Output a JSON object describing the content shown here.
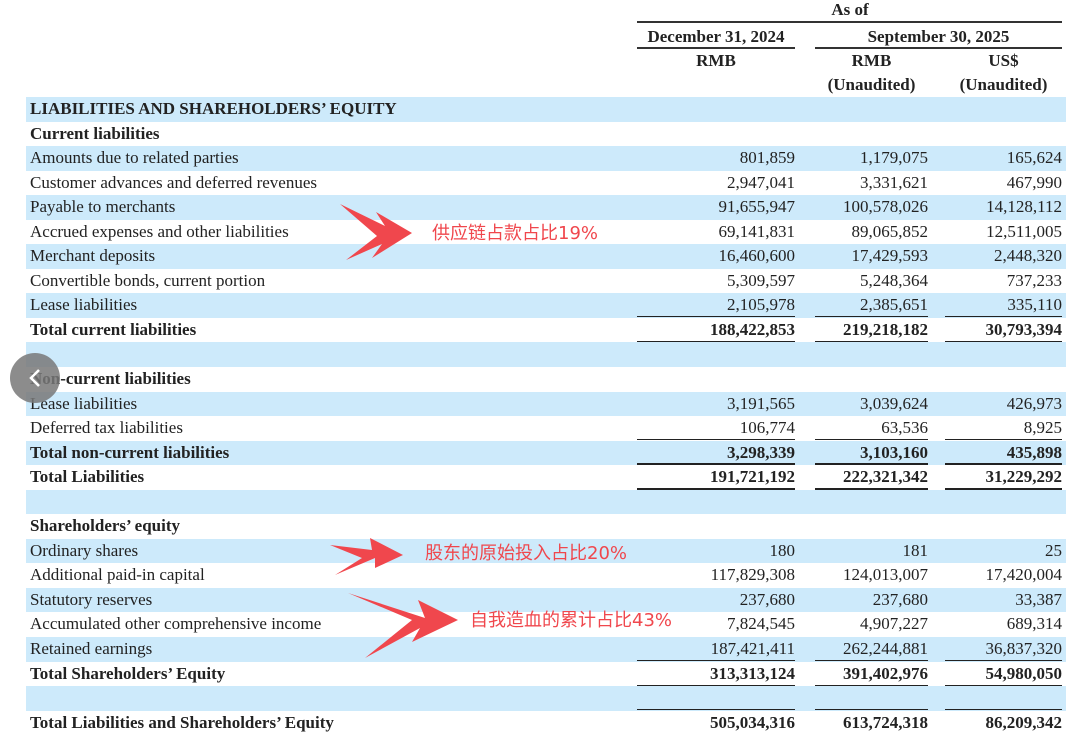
{
  "header": {
    "as_of": "As of",
    "date1": "December 31, 2024",
    "date2": "September 30, 2025",
    "cur1": "RMB",
    "cur2": "RMB",
    "cur3": "US$",
    "aud2": "(Unaudited)",
    "aud3": "(Unaudited)"
  },
  "rows": [
    {
      "label": "LIABILITIES AND SHAREHOLDERS’ EQUITY",
      "bold": true,
      "v": [
        "",
        "",
        ""
      ]
    },
    {
      "label": "Current liabilities",
      "bold": true,
      "v": [
        "",
        "",
        ""
      ]
    },
    {
      "label": "Amounts due to related parties",
      "v": [
        "801,859",
        "1,179,075",
        "165,624"
      ]
    },
    {
      "label": "Customer advances and deferred revenues",
      "v": [
        "2,947,041",
        "3,331,621",
        "467,990"
      ]
    },
    {
      "label": "Payable to merchants",
      "v": [
        "91,655,947",
        "100,578,026",
        "14,128,112"
      ]
    },
    {
      "label": "Accrued expenses and other liabilities",
      "v": [
        "69,141,831",
        "89,065,852",
        "12,511,005"
      ]
    },
    {
      "label": "Merchant deposits",
      "v": [
        "16,460,600",
        "17,429,593",
        "2,448,320"
      ]
    },
    {
      "label": "Convertible bonds, current portion",
      "v": [
        "5,309,597",
        "5,248,364",
        "737,233"
      ]
    },
    {
      "label": "Lease liabilities",
      "v": [
        "2,105,978",
        "2,385,651",
        "335,110"
      ]
    },
    {
      "label": "Total current liabilities",
      "bold": true,
      "total": true,
      "v": [
        "188,422,853",
        "219,218,182",
        "30,793,394"
      ]
    },
    {
      "label": "",
      "v": [
        "",
        "",
        ""
      ]
    },
    {
      "label": "Non-current liabilities",
      "bold": true,
      "v": [
        "",
        "",
        ""
      ]
    },
    {
      "label": "Lease liabilities",
      "v": [
        "3,191,565",
        "3,039,624",
        "426,973"
      ]
    },
    {
      "label": "Deferred tax liabilities",
      "v": [
        "106,774",
        "63,536",
        "8,925"
      ]
    },
    {
      "label": "Total non-current liabilities",
      "bold": true,
      "total": true,
      "v": [
        "3,298,339",
        "3,103,160",
        "435,898"
      ]
    },
    {
      "label": "Total Liabilities",
      "bold": true,
      "total": true,
      "v": [
        "191,721,192",
        "222,321,342",
        "31,229,292"
      ]
    },
    {
      "label": "",
      "v": [
        "",
        "",
        ""
      ]
    },
    {
      "label": "Shareholders’ equity",
      "bold": true,
      "v": [
        "",
        "",
        ""
      ]
    },
    {
      "label": "Ordinary shares",
      "v": [
        "180",
        "181",
        "25"
      ]
    },
    {
      "label": "Additional paid-in capital",
      "v": [
        "117,829,308",
        "124,013,007",
        "17,420,004"
      ]
    },
    {
      "label": "Statutory reserves",
      "v": [
        "237,680",
        "237,680",
        "33,387"
      ]
    },
    {
      "label": "Accumulated other comprehensive income",
      "v": [
        "7,824,545",
        "4,907,227",
        "689,314"
      ]
    },
    {
      "label": "Retained earnings",
      "v": [
        "187,421,411",
        "262,244,881",
        "36,837,320"
      ]
    },
    {
      "label": "Total Shareholders’ Equity",
      "bold": true,
      "total": true,
      "v": [
        "313,313,124",
        "391,402,976",
        "54,980,050"
      ]
    },
    {
      "label": "",
      "v": [
        "",
        "",
        ""
      ]
    },
    {
      "label": "Total Liabilities and Shareholders’ Equity",
      "bold": true,
      "v": [
        "505,034,316",
        "613,724,318",
        "86,209,342"
      ]
    }
  ],
  "annotations": {
    "supply_chain": "供应链占款占比19%",
    "shareholder_input": "股东的原始投入占比20%",
    "self_generated": "自我造血的累计占比43%",
    "color": "#f0474d"
  },
  "colors": {
    "row_band": "#cdeafb"
  }
}
